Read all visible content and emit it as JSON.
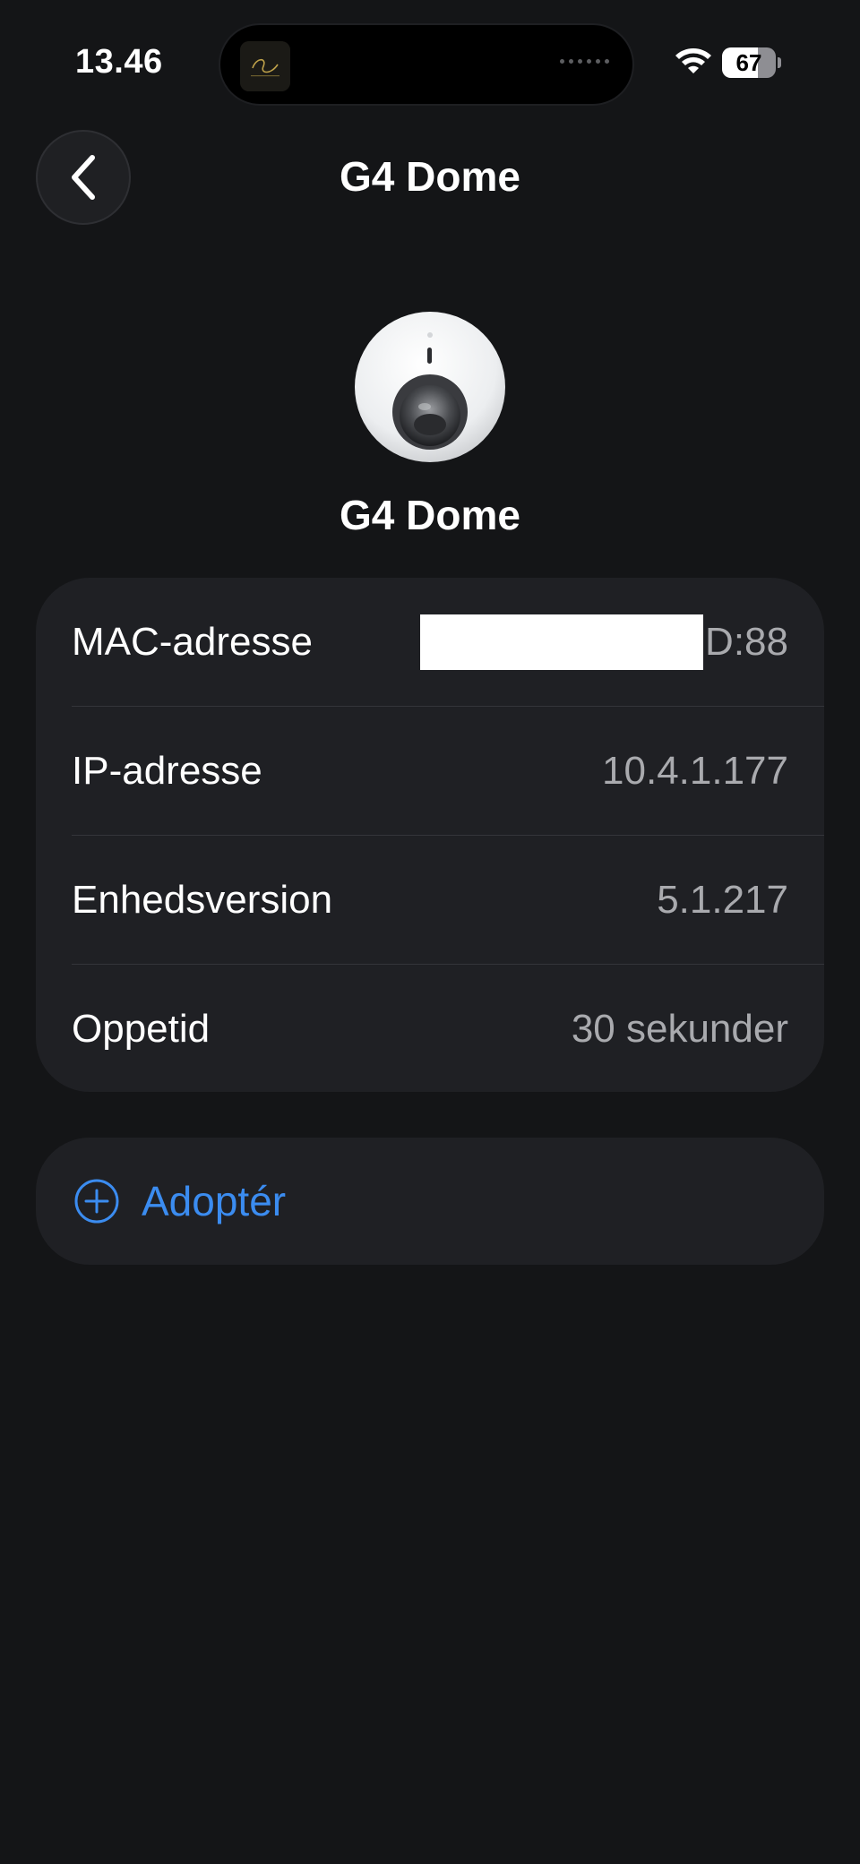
{
  "status_bar": {
    "time": "13.46",
    "battery_level": "67",
    "icons": [
      "wifi-icon",
      "battery-icon"
    ]
  },
  "header": {
    "title": "G4 Dome",
    "back_icon": "chevron-left-icon"
  },
  "device": {
    "name": "G4 Dome",
    "image_icon": "dome-camera-icon"
  },
  "info": {
    "rows": [
      {
        "label": "MAC-adresse",
        "value": "D:88",
        "redacted_prefix": true
      },
      {
        "label": "IP-adresse",
        "value": "10.4.1.177"
      },
      {
        "label": "Enhedsversion",
        "value": "5.1.217"
      },
      {
        "label": "Oppetid",
        "value": "30 sekunder"
      }
    ]
  },
  "actions": {
    "adopt_label": "Adoptér",
    "adopt_icon": "plus-circle-icon"
  },
  "colors": {
    "background": "#141517",
    "card": "#1f2024",
    "accent": "#3b8cf0",
    "secondary_text": "#a9aaae"
  }
}
